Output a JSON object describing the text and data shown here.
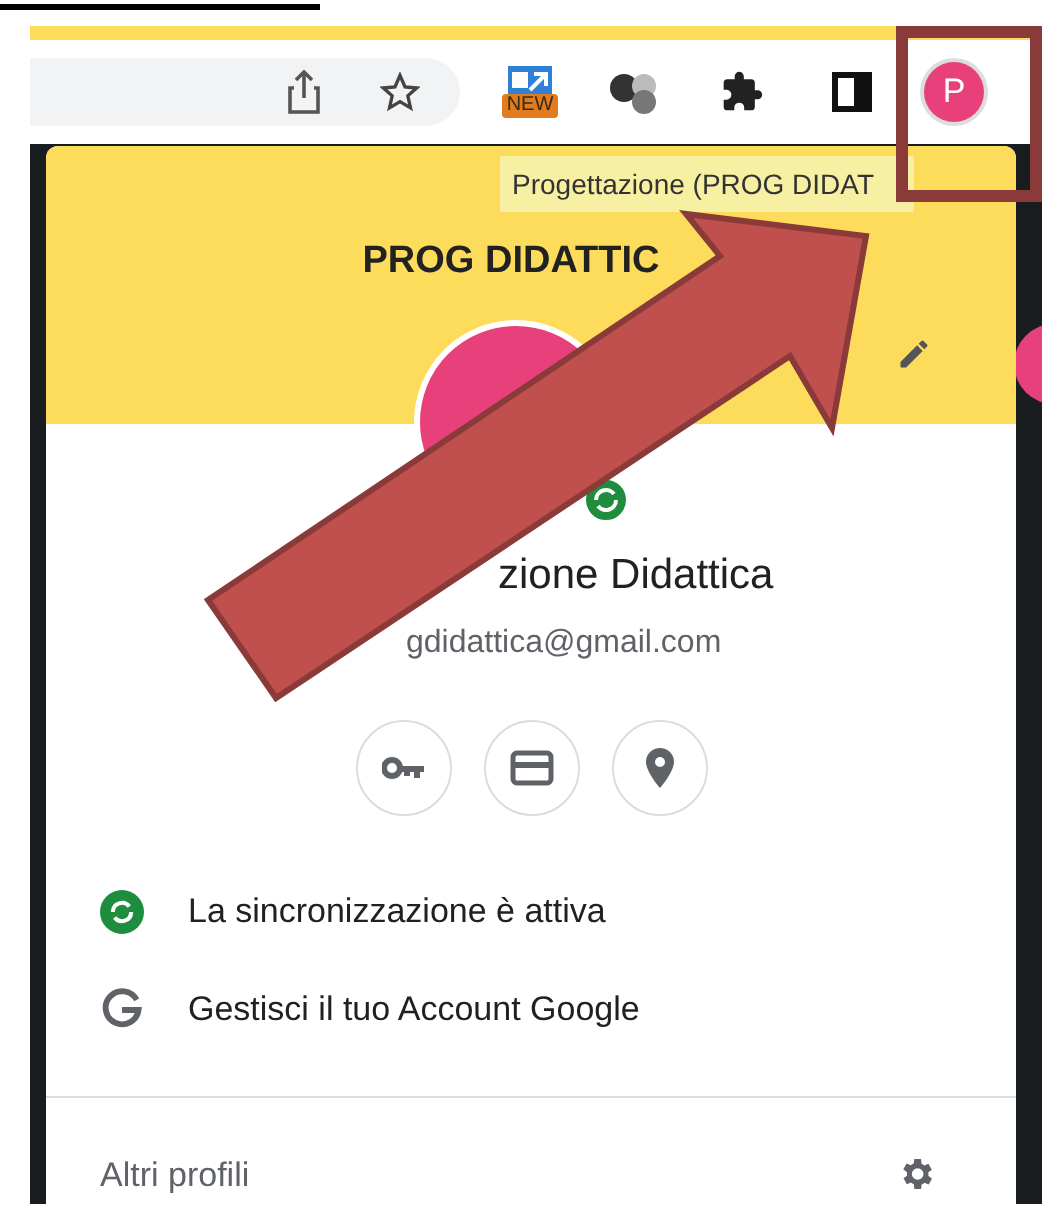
{
  "toolbar": {
    "extension_badge": "NEW",
    "avatar_letter": "P"
  },
  "tooltip": "Progettazione (PROG DIDAT",
  "profile_menu": {
    "title": "PROG DIDATTIC",
    "name": "zione Didattica",
    "email": "gdidattica@gmail.com",
    "quick_buttons": [
      {
        "kind": "passwords"
      },
      {
        "kind": "payments"
      },
      {
        "kind": "addresses"
      }
    ],
    "items": [
      {
        "kind": "sync",
        "label": "La sincronizzazione è attiva"
      },
      {
        "kind": "google",
        "label": "Gestisci il tuo Account Google"
      }
    ],
    "other_profiles": "Altri profili"
  }
}
